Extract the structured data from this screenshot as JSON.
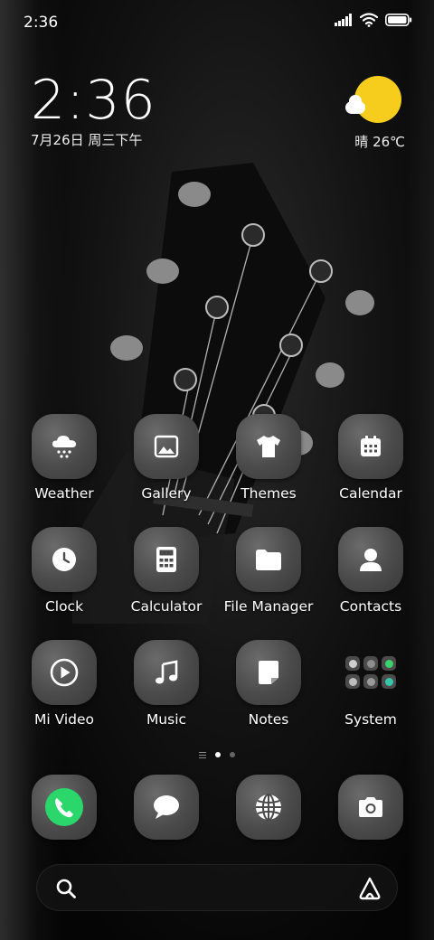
{
  "status_bar": {
    "time": "2:36",
    "icons": [
      "signal-icon",
      "wifi-icon",
      "battery-icon"
    ]
  },
  "clock_widget": {
    "time": "2:36",
    "date": "7月26日 周三下午"
  },
  "weather_widget": {
    "icon": "sun-cloud-icon",
    "text": "晴 26℃"
  },
  "apps": [
    {
      "label": "Weather",
      "icon": "weather-snow-cloud-icon"
    },
    {
      "label": "Gallery",
      "icon": "gallery-image-icon"
    },
    {
      "label": "Themes",
      "icon": "tshirt-icon"
    },
    {
      "label": "Calendar",
      "icon": "calendar-icon"
    },
    {
      "label": "Clock",
      "icon": "clock-icon"
    },
    {
      "label": "Calculator",
      "icon": "calculator-icon"
    },
    {
      "label": "File Manager",
      "icon": "folder-icon"
    },
    {
      "label": "Contacts",
      "icon": "person-icon"
    },
    {
      "label": "Mi Video",
      "icon": "play-icon"
    },
    {
      "label": "Music",
      "icon": "music-note-icon"
    },
    {
      "label": "Notes",
      "icon": "note-icon"
    },
    {
      "label": "System",
      "icon": "folder-group-icon"
    }
  ],
  "page_indicator": {
    "pages": 2,
    "active": 1
  },
  "dock": [
    {
      "name": "phone",
      "icon": "phone-icon",
      "color": "#2bd76b"
    },
    {
      "name": "messages",
      "icon": "message-icon"
    },
    {
      "name": "browser",
      "icon": "globe-icon"
    },
    {
      "name": "camera",
      "icon": "camera-icon"
    }
  ],
  "search_bar": {
    "left_icon": "search-icon",
    "right_icon": "assistant-icon"
  },
  "colors": {
    "accent_sun": "#f6cd1d",
    "phone_green": "#2bd76b",
    "tile_gray": "#4a4a4a"
  }
}
